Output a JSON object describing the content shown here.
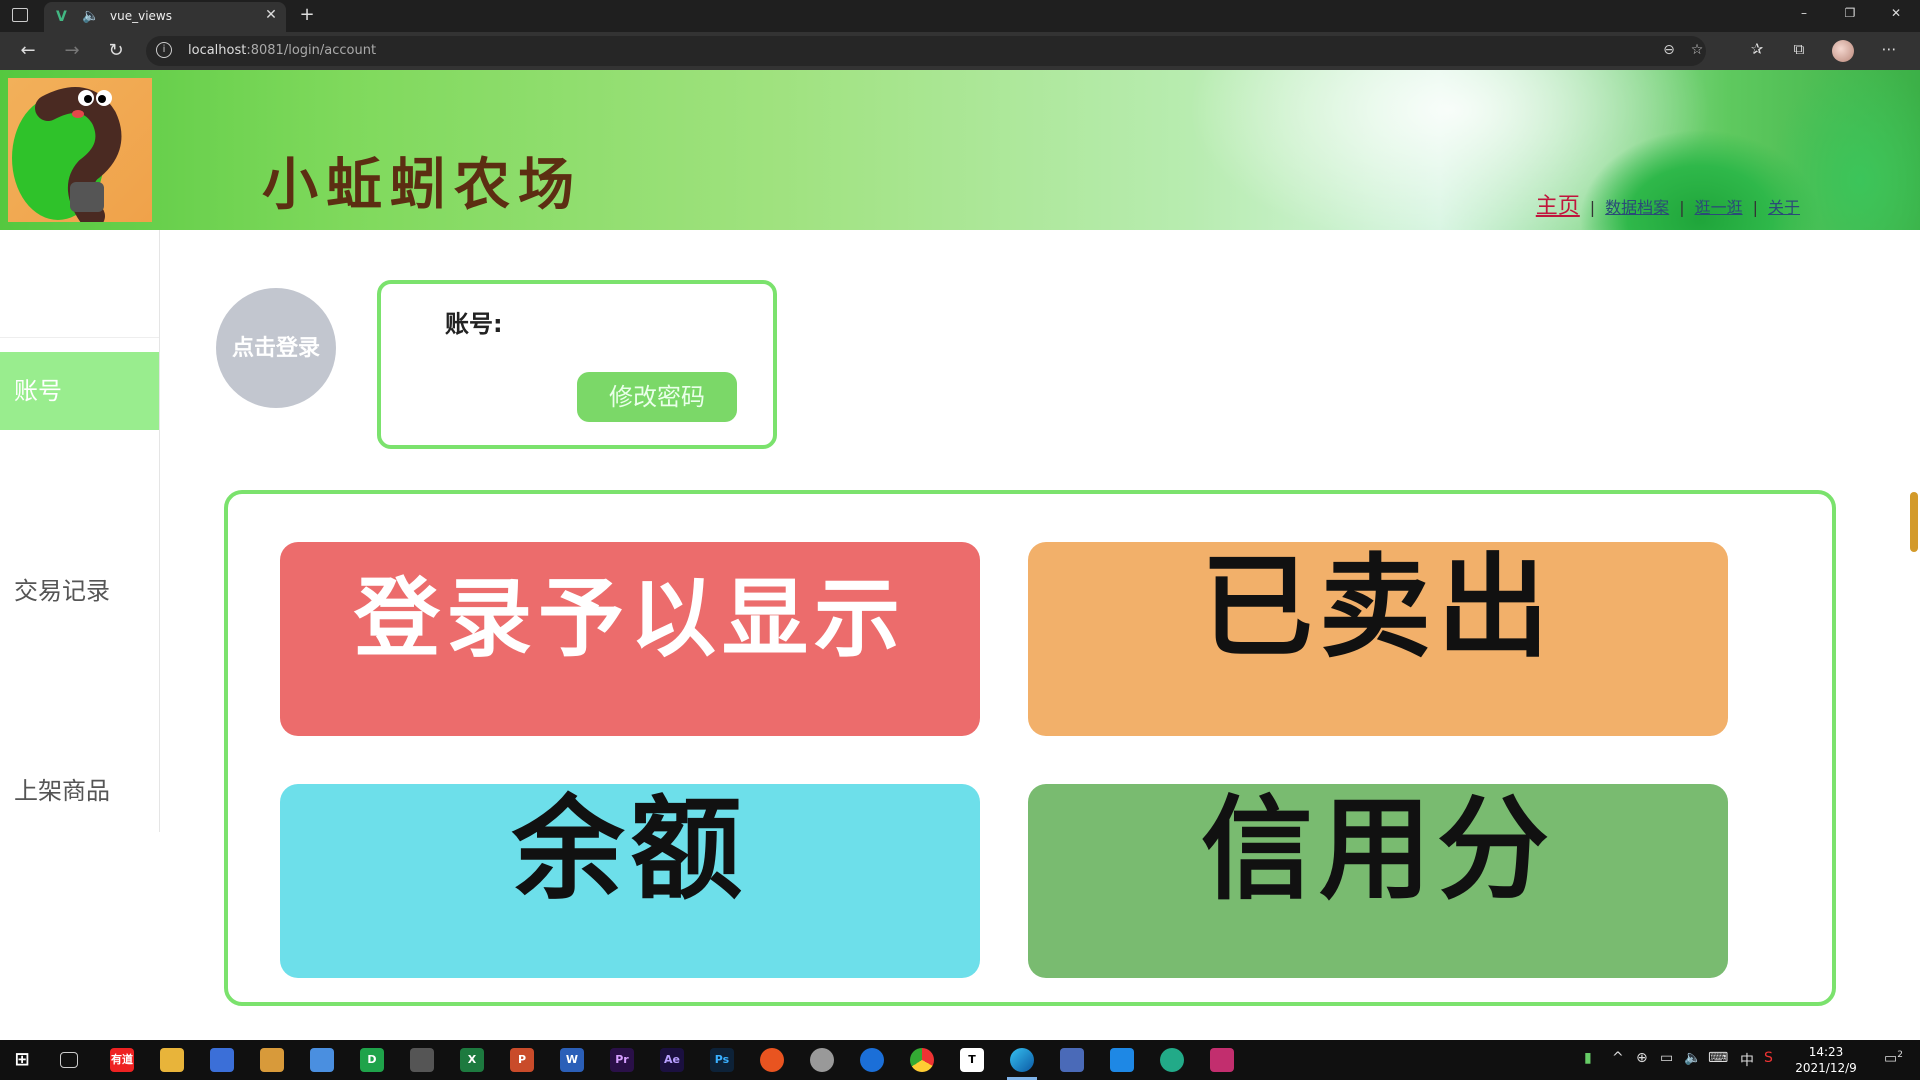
{
  "browser": {
    "tab_title": "vue_views",
    "tab_close": "✕",
    "new_tab": "+",
    "url_host": "localhost",
    "url_rest": ":8081/login/account",
    "window": {
      "minimize": "–",
      "restore": "❐",
      "close": "✕"
    }
  },
  "banner": {
    "title": "小蚯蚓农场",
    "nav": [
      {
        "label": "主页",
        "active": true
      },
      {
        "label": "数据档案"
      },
      {
        "label": "逛一逛"
      },
      {
        "label": "关于"
      }
    ],
    "separator": "|"
  },
  "sidebar": {
    "items": [
      {
        "label": "账号",
        "active": true
      },
      {
        "label": "交易记录"
      },
      {
        "label": "上架商品"
      }
    ]
  },
  "account": {
    "avatar_text": "点击登录",
    "label": "账号:",
    "change_password": "修改密码"
  },
  "stats": [
    {
      "text": "登录予以显示",
      "color": "#ec6c6c"
    },
    {
      "text": "已卖出",
      "color": "#f2b06a"
    },
    {
      "text": "余额",
      "color": "#6ddfea"
    },
    {
      "text": "信用分",
      "color": "#79bb70"
    }
  ],
  "taskbar": {
    "clock_time": "14:23",
    "clock_date": "2021/12/9",
    "ime": "中",
    "notification_count": "2"
  }
}
